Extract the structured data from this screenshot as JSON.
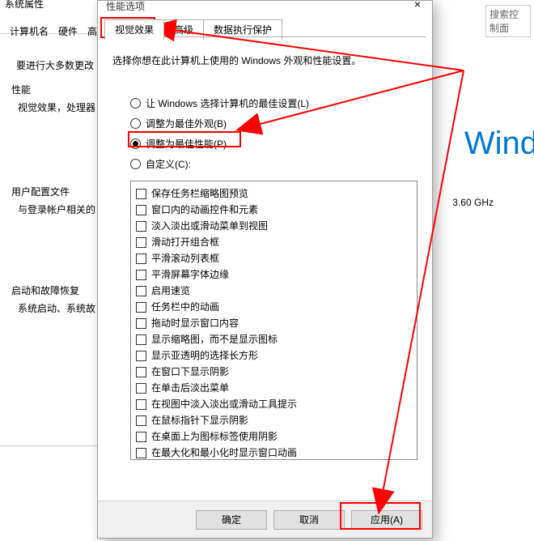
{
  "bg": {
    "titlebar": "系统属性",
    "tab_computer": "计算机名",
    "tab_hardware": "硬件",
    "tab_adv_char": "高",
    "desc_line": "要进行大多数更改",
    "grp_perf": "性能",
    "perf_sub": "视觉效果，处理器",
    "grp_user": "用户配置文件",
    "user_sub": "与登录帐户相关的",
    "grp_boot": "启动和故障恢复",
    "boot_sub": "系统启动、系统故",
    "wind": "Wind",
    "ghz": "3.60 GHz",
    "search": "搜索控制面"
  },
  "dlg": {
    "title": "性能选项",
    "close": "×",
    "tabs": [
      "视觉效果",
      "高级",
      "数据执行保护"
    ],
    "desc": "选择你想在此计算机上使用的 Windows 外观和性能设置。",
    "radios": [
      "让 Windows 选择计算机的最佳设置(L)",
      "调整为最佳外观(B)",
      "调整为最佳性能(P)",
      "自定义(C):"
    ],
    "selected": 2,
    "checks": [
      "保存任务栏缩略图预览",
      "窗口内的动画控件和元素",
      "淡入淡出或滑动菜单到视图",
      "滑动打开组合框",
      "平滑滚动列表框",
      "平滑屏幕字体边缘",
      "启用速览",
      "任务栏中的动画",
      "拖动时显示窗口内容",
      "显示缩略图，而不是显示图标",
      "显示亚透明的选择长方形",
      "在窗口下显示阴影",
      "在单击后淡出菜单",
      "在视图中淡入淡出或滑动工具提示",
      "在鼠标指针下显示阴影",
      "在桌面上为图标标签使用阴影",
      "在最大化和最小化时显示窗口动画"
    ],
    "buttons": {
      "ok": "确定",
      "cancel": "取消",
      "apply": "应用(A)"
    }
  }
}
